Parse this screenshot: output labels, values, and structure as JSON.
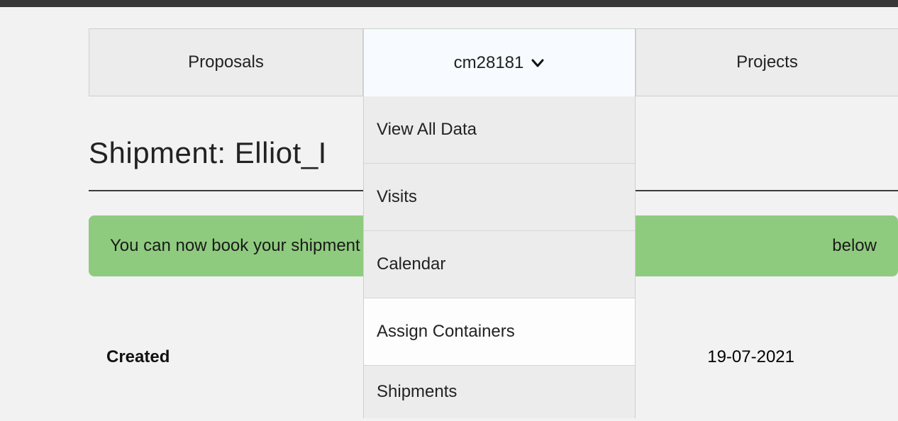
{
  "tabs": {
    "proposals": "Proposals",
    "active": "cm28181",
    "projects": "Projects"
  },
  "dropdown": {
    "items": [
      "View All Data",
      "Visits",
      "Calendar",
      "Assign Containers",
      "Shipments"
    ]
  },
  "heading_prefix": "Shipment: ",
  "heading_name": "Elliot_I",
  "alert_left": "You can now book your shipment",
  "alert_right": "below",
  "details": {
    "created_label": "Created",
    "created_value": "19-07-2021"
  }
}
